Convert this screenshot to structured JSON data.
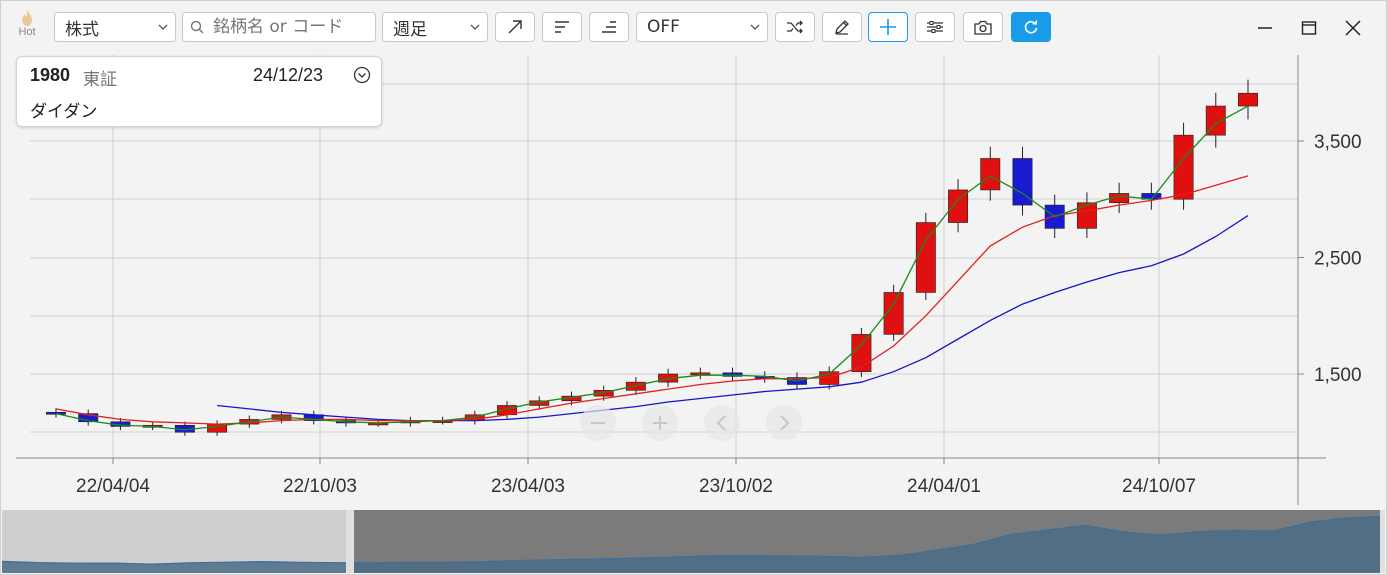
{
  "toolbar": {
    "hot_label": "Hot",
    "category": "株式",
    "search_placeholder": "銘柄名 or コード",
    "period": "週足",
    "indicator": "OFF",
    "refresh_color": "#1a9bea"
  },
  "info": {
    "code": "1980",
    "market": "東証",
    "date": "24/12/23",
    "name": "ダイダン"
  },
  "colors": {
    "up": "#e01010",
    "down": "#1a1ad0",
    "ma_short": "#1a8a1a",
    "ma_mid": "#e02020",
    "ma_long": "#1515c8"
  },
  "chart_data": {
    "type": "line",
    "series_type": "candlestick",
    "x_tick_labels": [
      "22/04/04",
      "22/10/03",
      "23/04/03",
      "23/10/02",
      "24/04/01",
      "24/10/07"
    ],
    "y_tick_labels": [
      "3,500",
      "2,500",
      "1,500"
    ],
    "y_ticks": [
      3500,
      2500,
      1500
    ],
    "ylim": [
      760,
      4250
    ],
    "x": [
      "22/02/28",
      "22/03/28",
      "22/04/25",
      "22/05/23",
      "22/06/20",
      "22/07/18",
      "22/08/15",
      "22/09/12",
      "22/10/10",
      "22/11/07",
      "22/12/05",
      "23/01/02",
      "23/01/30",
      "23/02/27",
      "23/03/27",
      "23/04/24",
      "23/05/22",
      "23/06/19",
      "23/07/17",
      "23/08/14",
      "23/09/11",
      "23/10/09",
      "23/11/06",
      "23/12/04",
      "24/01/01",
      "24/01/29",
      "24/02/26",
      "24/03/25",
      "24/04/22",
      "24/05/20",
      "24/06/17",
      "24/07/15",
      "24/08/12",
      "24/09/09",
      "24/10/07",
      "24/11/04",
      "24/12/02",
      "24/12/23"
    ],
    "close": [
      1160,
      1090,
      1050,
      1060,
      1000,
      1070,
      1110,
      1150,
      1100,
      1080,
      1080,
      1100,
      1100,
      1150,
      1230,
      1270,
      1310,
      1360,
      1430,
      1500,
      1510,
      1480,
      1470,
      1410,
      1520,
      1840,
      2200,
      2800,
      3080,
      3350,
      2950,
      2750,
      2970,
      3050,
      3000,
      3550,
      3800,
      3910
    ],
    "ma_short": [
      1160,
      1100,
      1060,
      1050,
      1020,
      1050,
      1090,
      1130,
      1110,
      1090,
      1080,
      1090,
      1100,
      1130,
      1200,
      1260,
      1300,
      1340,
      1400,
      1460,
      1490,
      1490,
      1480,
      1440,
      1500,
      1750,
      2100,
      2650,
      3000,
      3200,
      3050,
      2850,
      2950,
      3030,
      3000,
      3350,
      3650,
      3800
    ],
    "ma_mid": [
      1200,
      1150,
      1110,
      1090,
      1080,
      1070,
      1080,
      1100,
      1110,
      1110,
      1100,
      1100,
      1100,
      1110,
      1150,
      1200,
      1250,
      1290,
      1330,
      1370,
      1410,
      1440,
      1460,
      1460,
      1470,
      1560,
      1740,
      2000,
      2300,
      2600,
      2760,
      2860,
      2900,
      2950,
      2990,
      3040,
      3120,
      3200
    ],
    "ma_long": [
      null,
      null,
      null,
      null,
      null,
      1230,
      1200,
      1170,
      1150,
      1130,
      1110,
      1100,
      1100,
      1100,
      1110,
      1130,
      1160,
      1190,
      1220,
      1260,
      1290,
      1320,
      1350,
      1370,
      1390,
      1430,
      1520,
      1640,
      1800,
      1960,
      2100,
      2200,
      2290,
      2370,
      2430,
      2530,
      2680,
      2860
    ],
    "grid": true,
    "navigator": true
  }
}
